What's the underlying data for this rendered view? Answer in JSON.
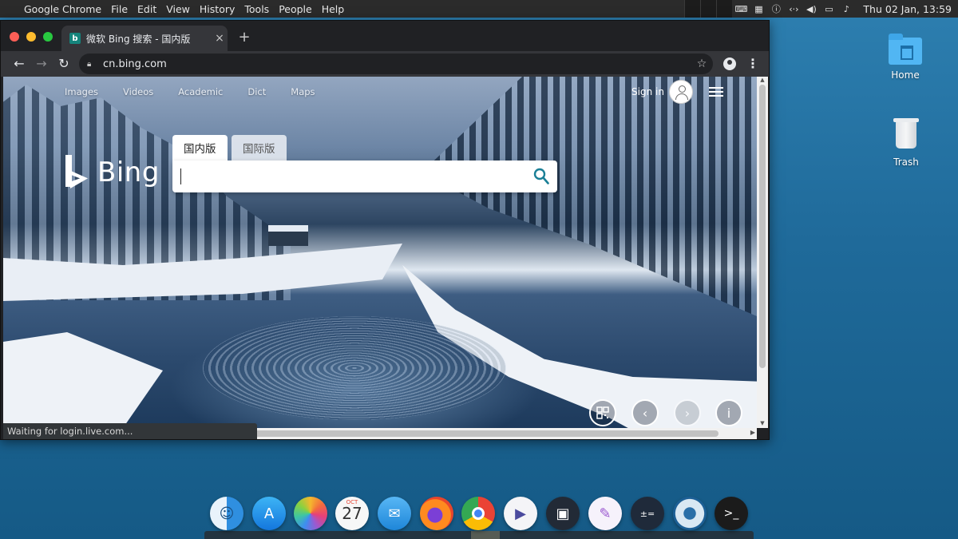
{
  "menubar": {
    "apple": "",
    "app_name": "Google Chrome",
    "menus": [
      "File",
      "Edit",
      "View",
      "History",
      "Tools",
      "People",
      "Help"
    ],
    "clock": "Thu 02 Jan, 13:59"
  },
  "browser": {
    "tab_title": "微软 Bing 搜索 - 国内版",
    "tab_close": "×",
    "new_tab": "+",
    "favicon": "b",
    "url": "cn.bing.com",
    "status_text": "Waiting for login.live.com..."
  },
  "bing": {
    "nav": [
      "Images",
      "Videos",
      "Academic",
      "Dict",
      "Maps"
    ],
    "sign_in": "Sign in",
    "logo_text": "Bing",
    "scope_tabs": [
      "国内版",
      "国际版"
    ],
    "active_scope": "国内版",
    "search_value": "",
    "image_controls": [
      "qr-code-icon",
      "chevron-left-icon",
      "chevron-right-icon",
      "info-icon"
    ]
  },
  "desktop": {
    "icons": [
      {
        "label": "Home",
        "icon": "folder-icon"
      },
      {
        "label": "Trash",
        "icon": "trash-icon"
      }
    ]
  },
  "dock": {
    "apps": [
      "finder",
      "app-store",
      "photos",
      "calendar",
      "mail",
      "firefox",
      "chrome",
      "video-player",
      "screenshot",
      "text-editor",
      "calculator",
      "disk-utility",
      "terminal"
    ],
    "calendar_day": "27",
    "calendar_month": "OCT"
  }
}
